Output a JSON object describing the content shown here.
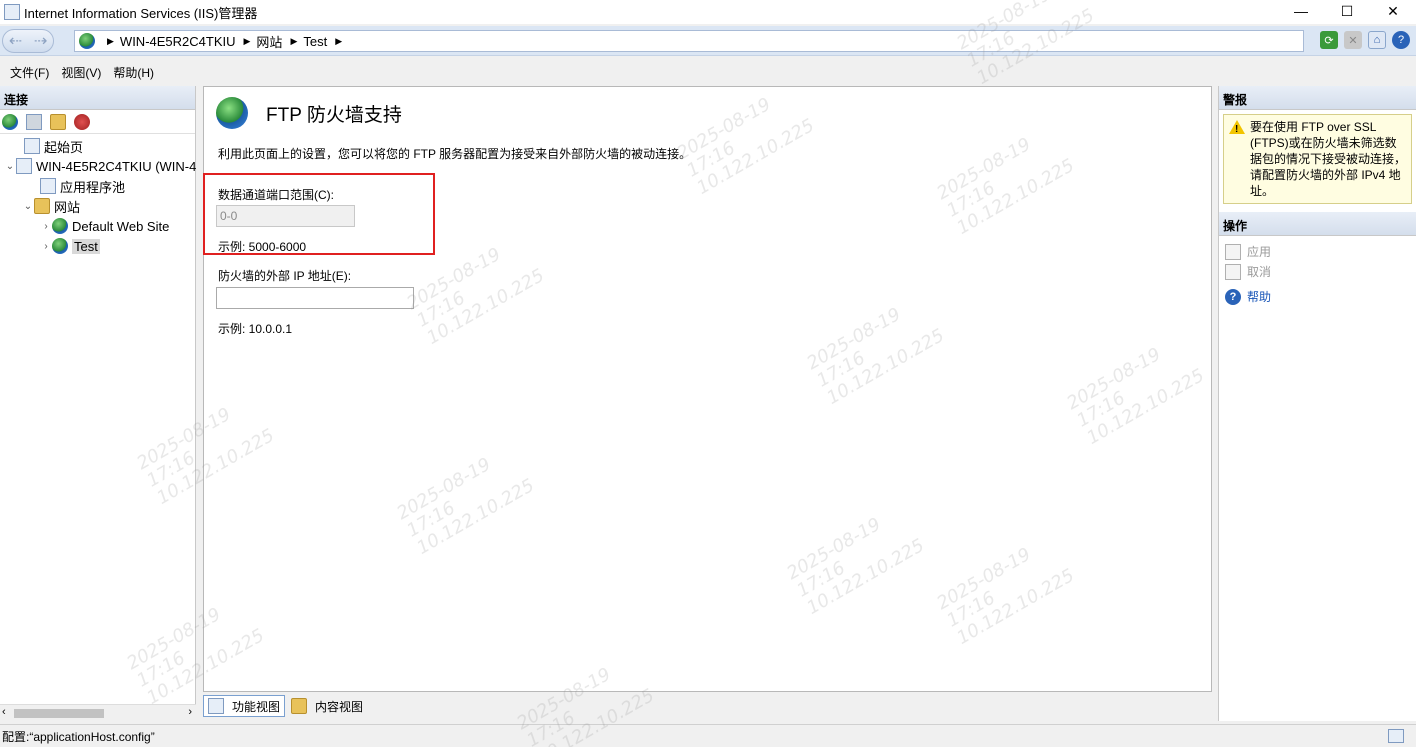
{
  "window": {
    "title": "Internet Information Services (IIS)管理器",
    "controls": {
      "minimize": "—",
      "maximize": "☐",
      "close": "✕"
    }
  },
  "address": {
    "crumbs": [
      "WIN-4E5R2C4TKIU",
      "网站",
      "Test"
    ]
  },
  "menu": [
    "文件(F)",
    "视图(V)",
    "帮助(H)"
  ],
  "connections": {
    "header": "连接",
    "tree": {
      "start_page": "起始页",
      "server": "WIN-4E5R2C4TKIU (WIN-4",
      "app_pools": "应用程序池",
      "sites": "网站",
      "default_site": "Default Web Site",
      "test_site": "Test"
    }
  },
  "main": {
    "title": "FTP 防火墙支持",
    "description": "利用此页面上的设置，您可以将您的 FTP 服务器配置为接受来自外部防火墙的被动连接。",
    "port_range": {
      "label": "数据通道端口范围(C):",
      "placeholder": "0-0",
      "example": "示例: 5000-6000"
    },
    "external_ip": {
      "label": "防火墙的外部 IP 地址(E):",
      "value": "",
      "example": "示例: 10.0.0.1"
    }
  },
  "view_tabs": [
    "功能视图",
    "内容视图"
  ],
  "alerts": {
    "header": "警报",
    "message": "要在使用 FTP over SSL (FTPS)或在防火墙未筛选数据包的情况下接受被动连接，请配置防火墙的外部 IPv4 地址。"
  },
  "actions": {
    "header": "操作",
    "apply": "应用",
    "cancel": "取消",
    "help": "帮助"
  },
  "status": {
    "text": "配置:“applicationHost.config”"
  },
  "watermark": {
    "date": "2025-08-19",
    "time": "17:16",
    "ip": "10.122.10.225"
  }
}
